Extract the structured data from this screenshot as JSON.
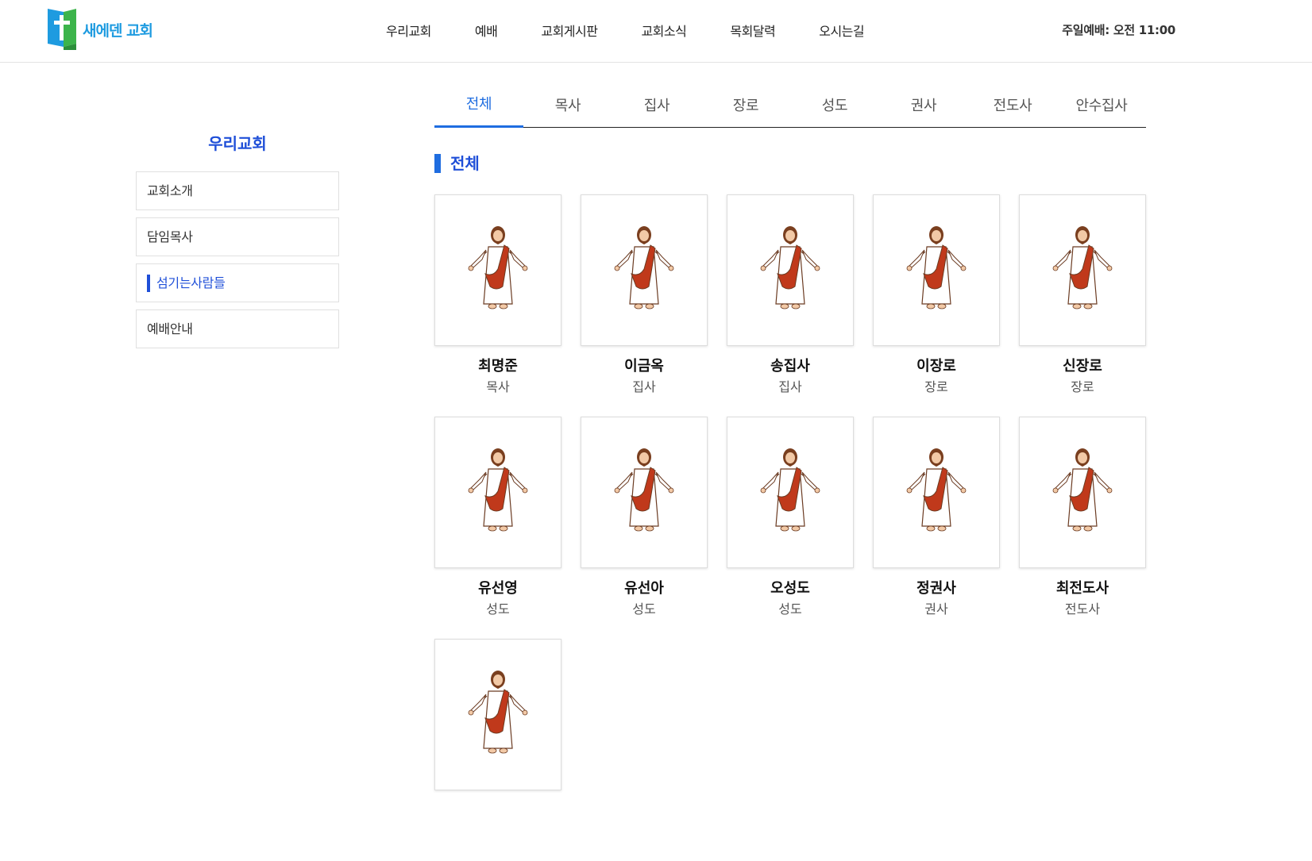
{
  "header": {
    "logo_text": "새에덴 교회",
    "nav": [
      "우리교회",
      "예배",
      "교회게시판",
      "교회소식",
      "목회달력",
      "오시는길"
    ],
    "service_time": "주일예배: 오전 11:00"
  },
  "sidebar": {
    "title": "우리교회",
    "items": [
      {
        "label": "교회소개"
      },
      {
        "label": "담임목사"
      },
      {
        "label": "섬기는사람들"
      },
      {
        "label": "예배안내"
      }
    ],
    "active_index": 2
  },
  "tabs": [
    "전체",
    "목사",
    "집사",
    "장로",
    "성도",
    "권사",
    "전도사",
    "안수집사"
  ],
  "active_tab": "전체",
  "section_title": "전체",
  "members": [
    {
      "name": "최명준",
      "role": "목사"
    },
    {
      "name": "이금옥",
      "role": "집사"
    },
    {
      "name": "송집사",
      "role": "집사"
    },
    {
      "name": "이장로",
      "role": "장로"
    },
    {
      "name": "신장로",
      "role": "장로"
    },
    {
      "name": "유선영",
      "role": "성도"
    },
    {
      "name": "유선아",
      "role": "성도"
    },
    {
      "name": "오성도",
      "role": "성도"
    },
    {
      "name": "정권사",
      "role": "권사"
    },
    {
      "name": "최전도사",
      "role": "전도사"
    },
    {
      "name": "",
      "role": ""
    }
  ],
  "colors": {
    "accent": "#1f4fd8",
    "tab_active": "#1f6de0",
    "logo_blue": "#1e9be0",
    "logo_green": "#3cb44b"
  }
}
